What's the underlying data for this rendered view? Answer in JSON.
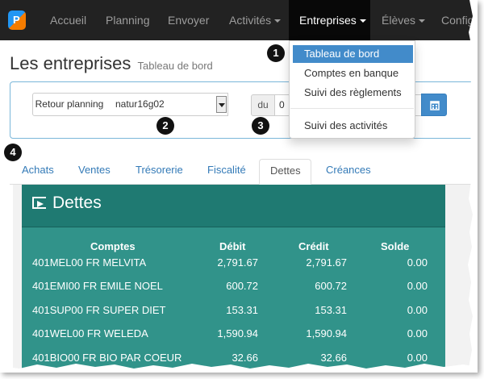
{
  "navbar": {
    "items": [
      "Accueil",
      "Planning",
      "Envoyer",
      "Activités",
      "Entreprises",
      "Élèves",
      "Configu"
    ],
    "active": "Entreprises"
  },
  "dropdown": {
    "items": [
      "Tableau de bord",
      "Comptes en banque",
      "Suivi des règlements",
      "Suivi des activités"
    ],
    "active": "Tableau de bord"
  },
  "header": {
    "title": "Les entreprises",
    "subtitle": "Tableau de bord"
  },
  "controls": {
    "retour_label": "Retour planning",
    "select_value": "natur16g02",
    "du_label": "du",
    "date_value": "0"
  },
  "badges": [
    "1",
    "2",
    "3",
    "4"
  ],
  "tabs": [
    "Achats",
    "Ventes",
    "Trésorerie",
    "Fiscalité",
    "Dettes",
    "Créances"
  ],
  "active_tab": "Dettes",
  "dettes": {
    "title": "Dettes",
    "columns": [
      "Comptes",
      "Débit",
      "Crédit",
      "Solde"
    ],
    "rows": [
      [
        "401MEL00 FR MELVITA",
        "2,791.67",
        "2,791.67",
        "0.00"
      ],
      [
        "401EMI00 FR EMILE NOEL",
        "600.72",
        "600.72",
        "0.00"
      ],
      [
        "401SUP00 FR SUPER DIET",
        "153.31",
        "153.31",
        "0.00"
      ],
      [
        "401WEL00 FR WELEDA",
        "1,590.94",
        "1,590.94",
        "0.00"
      ],
      [
        "401BIO00 FR BIO PAR COEUR",
        "32.66",
        "32.66",
        "0.00"
      ]
    ]
  },
  "colors": {
    "navbar": "#222222",
    "accent": "#428bca",
    "dettes_header": "#1f7a72",
    "dettes_body": "#31938a",
    "link": "#337ab7"
  }
}
